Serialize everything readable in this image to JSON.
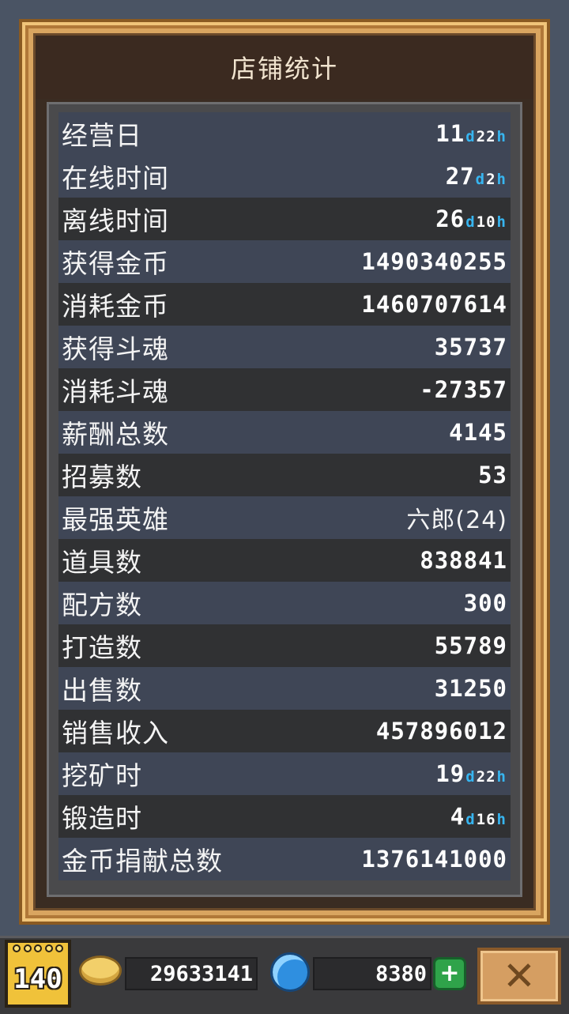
{
  "title": "店铺统计",
  "stats": [
    {
      "label": "经营日",
      "value": "11",
      "unit1": "d",
      "value2": "22",
      "unit2": "h",
      "style": "alt"
    },
    {
      "label": "在线时间",
      "value": "27",
      "unit1": "d",
      "value2": "2",
      "unit2": "h",
      "style": "alt"
    },
    {
      "label": "离线时间",
      "value": "26",
      "unit1": "d",
      "value2": "10",
      "unit2": "h",
      "style": "plain"
    },
    {
      "label": "获得金币",
      "value": "1490340255",
      "style": "alt"
    },
    {
      "label": "消耗金币",
      "value": "1460707614",
      "style": "plain"
    },
    {
      "label": "获得斗魂",
      "value": "35737",
      "style": "alt"
    },
    {
      "label": "消耗斗魂",
      "value": "-27357",
      "style": "plain"
    },
    {
      "label": "薪酬总数",
      "value": "4145",
      "style": "alt"
    },
    {
      "label": "招募数",
      "value": "53",
      "style": "plain"
    },
    {
      "label": "最强英雄",
      "value": "六郎(24)",
      "style": "alt"
    },
    {
      "label": "道具数",
      "value": "838841",
      "style": "plain"
    },
    {
      "label": "配方数",
      "value": "300",
      "style": "alt"
    },
    {
      "label": "打造数",
      "value": "55789",
      "style": "plain"
    },
    {
      "label": "出售数",
      "value": "31250",
      "style": "alt"
    },
    {
      "label": "销售收入",
      "value": "457896012",
      "style": "plain"
    },
    {
      "label": "挖矿时",
      "value": "19",
      "unit1": "d",
      "value2": "22",
      "unit2": "h",
      "style": "alt"
    },
    {
      "label": "锻造时",
      "value": "4",
      "unit1": "d",
      "value2": "16",
      "unit2": "h",
      "style": "plain"
    },
    {
      "label": "金币捐献总数",
      "value": "1376141000",
      "style": "alt"
    }
  ],
  "bottom_bar": {
    "level": "140",
    "gold": "29633141",
    "gems": "8380",
    "plus_label": "+",
    "close_label": "✕"
  },
  "colors": {
    "unit_accent": "#37b5f0",
    "row_alt": "#3f4656",
    "row_plain": "#303133",
    "frame_gold": "#d9a560"
  }
}
